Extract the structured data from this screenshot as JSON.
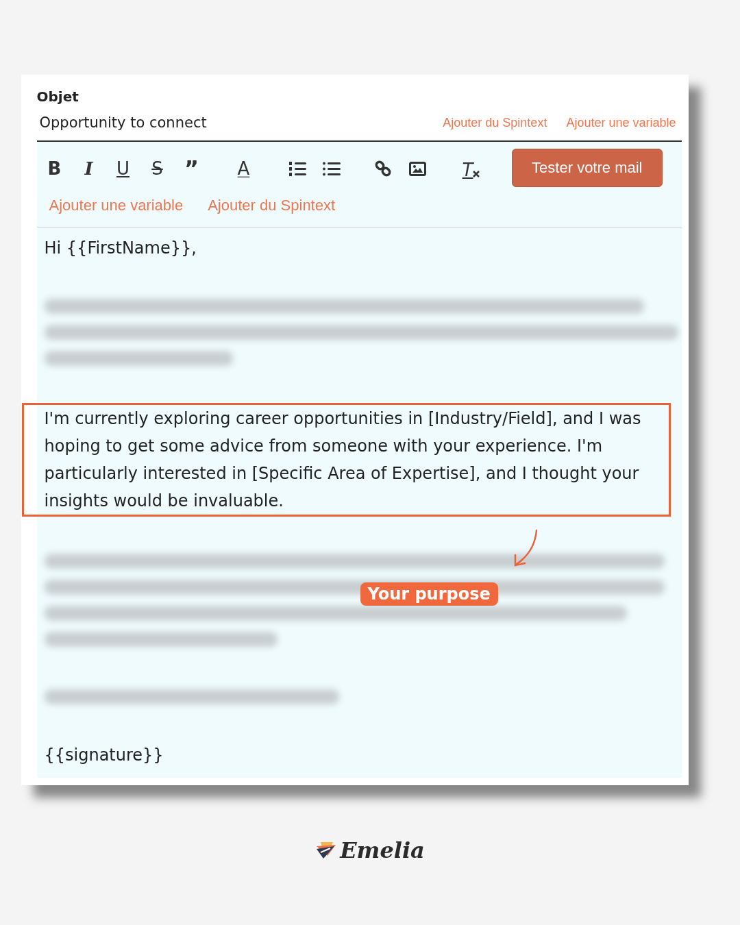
{
  "subject": {
    "label": "Objet",
    "value": "Opportunity to connect",
    "links": [
      "Ajouter du Spintext",
      "Ajouter une variable"
    ]
  },
  "toolbar": {
    "tools": [
      {
        "kind": "bold",
        "glyph": "B"
      },
      {
        "kind": "italic",
        "glyph": "I"
      },
      {
        "kind": "underline",
        "glyph": "U"
      },
      {
        "kind": "strike",
        "glyph": "S"
      },
      {
        "kind": "quote",
        "glyph": "”"
      },
      {
        "kind": "color",
        "glyph": "A"
      },
      {
        "kind": "ordered-list"
      },
      {
        "kind": "bullet-list"
      },
      {
        "kind": "link"
      },
      {
        "kind": "image"
      },
      {
        "kind": "clear",
        "glyph": "T"
      }
    ],
    "test_button": "Tester votre mail",
    "links": [
      "Ajouter une variable",
      "Ajouter du Spintext"
    ]
  },
  "body": [
    {
      "kind": "text",
      "text": "Hi {{FirstName}},"
    },
    {
      "kind": "blurred-medium"
    },
    {
      "kind": "highlighted",
      "text": "I'm currently exploring career opportunities in [Industry/Field], and I was hoping to get some advice from someone with your experience. I'm particularly interested in [Specific Area of Expertise], and I thought your insights would be invaluable."
    },
    {
      "kind": "blurred-long",
      "annotation": "Your purpose"
    },
    {
      "kind": "blurred-short"
    },
    {
      "kind": "text",
      "text": "{{signature}}"
    }
  ],
  "logo": {
    "text": "Emelia"
  }
}
